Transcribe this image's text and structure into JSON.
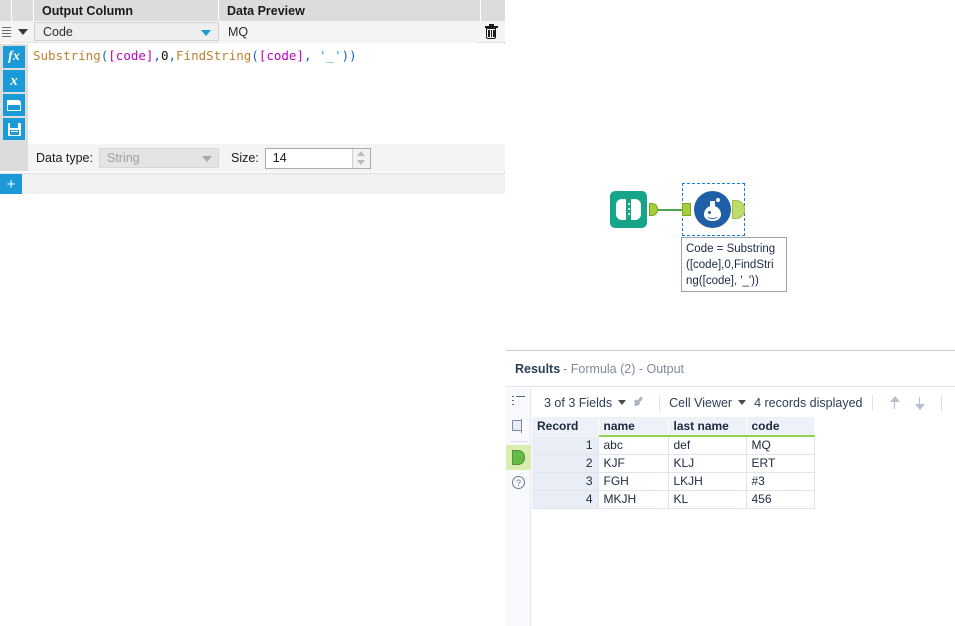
{
  "config": {
    "headers": {
      "output_column": "Output Column",
      "data_preview": "Data Preview"
    },
    "output_column_value": "Code",
    "data_preview_value": "MQ",
    "formula": {
      "tokens": [
        {
          "text": "Substring",
          "type": "function"
        },
        {
          "text": "(",
          "type": "paren"
        },
        {
          "text": "[code]",
          "type": "field"
        },
        {
          "text": ",",
          "type": "paren"
        },
        {
          "text": "0",
          "type": "number"
        },
        {
          "text": ",",
          "type": "paren"
        },
        {
          "text": "FindString",
          "type": "function"
        },
        {
          "text": "(",
          "type": "paren"
        },
        {
          "text": "[code]",
          "type": "field"
        },
        {
          "text": ", ",
          "type": "paren"
        },
        {
          "text": "'_'",
          "type": "string"
        },
        {
          "text": "))",
          "type": "paren"
        }
      ],
      "full_text": "Substring([code],0,FindString([code], '_'))"
    },
    "data_type_label": "Data type:",
    "data_type_value": "String",
    "size_label": "Size:",
    "size_value": "14",
    "add_button_label": "+",
    "toolbar_icons": [
      "fx-icon",
      "variable-icon",
      "open-folder-icon",
      "save-icon"
    ],
    "delete_icon": "trash-icon"
  },
  "canvas": {
    "input_tool": {
      "name": "input-data-tool",
      "icon": "book-icon"
    },
    "formula_tool": {
      "name": "formula-tool",
      "icon": "flask-icon",
      "selected": true
    },
    "annotation_lines": [
      "Code = Substring",
      "([code],0,FindStri",
      "ng([code], '_'))"
    ],
    "annotation_text": "Code = Substring([code],0,FindString([code], '_'))"
  },
  "results": {
    "title_bold": "Results",
    "title_rest": "- Formula (2) - Output",
    "toolbar": {
      "fields_label": "3 of 3 Fields",
      "view_mode": "Cell Viewer",
      "records_label": "4 records displayed"
    },
    "sidebar_icons": [
      "list-icon",
      "panel-icon",
      "output-anchor-icon",
      "help-icon"
    ],
    "table": {
      "columns": [
        "Record",
        "name",
        "last name",
        "code"
      ],
      "rows": [
        [
          "1",
          "abc",
          "def",
          "MQ"
        ],
        [
          "2",
          "KJF",
          "KLJ",
          "ERT"
        ],
        [
          "3",
          "FGH",
          "LKJH",
          "#3"
        ],
        [
          "4",
          "MKJH",
          "KL",
          "456"
        ]
      ]
    }
  },
  "colors": {
    "accent_blue": "#1a9ad6",
    "tool_green": "#17a589",
    "tool_blue": "#1f5fa8",
    "anchor_green": "#a5ce3a",
    "header_underline": "#8fd44c"
  }
}
